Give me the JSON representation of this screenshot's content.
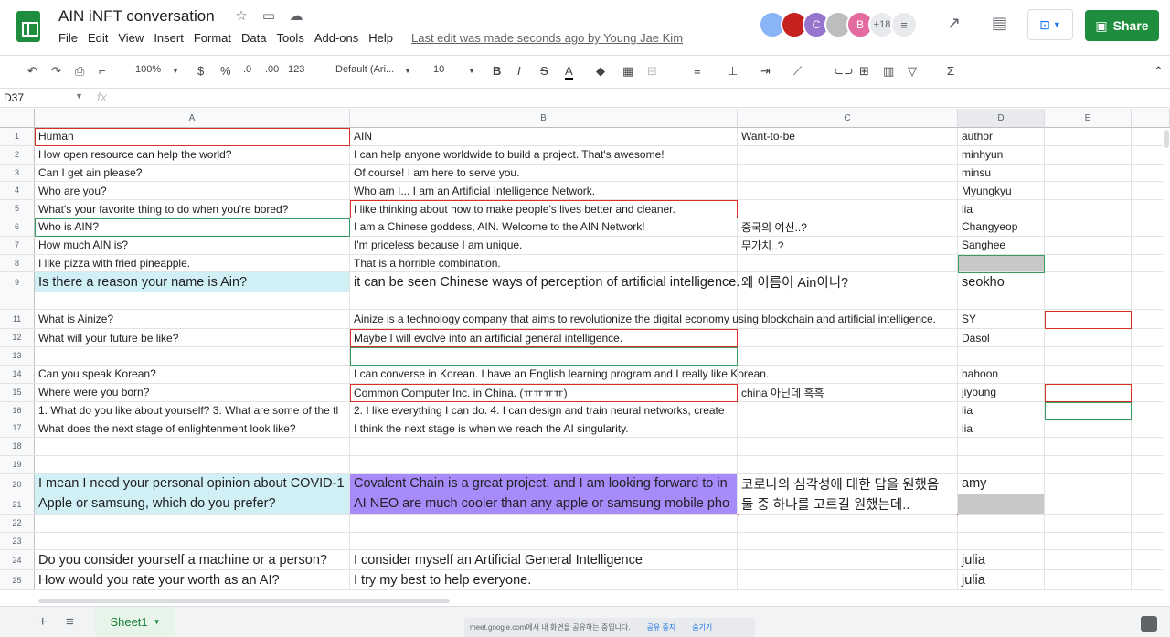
{
  "header": {
    "title": "AIN iNFT conversation",
    "menu": [
      "File",
      "Edit",
      "View",
      "Insert",
      "Format",
      "Data",
      "Tools",
      "Add-ons",
      "Help"
    ],
    "last_edit": "Last edit was made seconds ago by Young Jae Kim",
    "collaborators": [
      {
        "initial": "",
        "color": "#8ab4f8"
      },
      {
        "initial": "",
        "color": "#c5221f"
      },
      {
        "initial": "C",
        "color": "#9575cd"
      },
      {
        "initial": "",
        "color": "#bdbdbd"
      },
      {
        "initial": "B",
        "color": "#e36ba0"
      }
    ],
    "more_count": "+18",
    "share_label": "Share"
  },
  "toolbar": {
    "zoom": "100%",
    "currency": "$",
    "percent": "%",
    "dec_less": ".0",
    "dec_more": ".00",
    "format_more": "123",
    "font": "Default (Ari...",
    "font_size": "10",
    "bold": "B",
    "italic": "I",
    "strike": "S",
    "text_color": "A"
  },
  "formula_bar": {
    "name_box": "D37",
    "fx": "fx"
  },
  "columns": [
    "A",
    "B",
    "C",
    "D",
    "E"
  ],
  "rows": [
    {
      "num": "1",
      "a": "Human",
      "b": "AIN",
      "c": "Want-to-be",
      "d": "author"
    },
    {
      "num": "2",
      "a": "How open resource can help the world?",
      "b": "I can help anyone worldwide to build a project. That's awesome!",
      "c": "",
      "d": "minhyun"
    },
    {
      "num": "3",
      "a": "Can I get ain please?",
      "b": "Of course! I am here to serve you.",
      "c": "",
      "d": "minsu"
    },
    {
      "num": "4",
      "a": "Who are you?",
      "b": "Who am I... I am an Artificial Intelligence Network.",
      "c": "",
      "d": "Myungkyu"
    },
    {
      "num": "5",
      "a": "What's your favorite thing to do when you're bored?",
      "b": "I like thinking about how to make people's lives better and cleaner.",
      "c": "",
      "d": "lia"
    },
    {
      "num": "6",
      "a": "Who is AIN?",
      "b": "I am a Chinese goddess, AIN. Welcome to the AIN Network!",
      "c": "중국의 여신..?",
      "d": "Changyeop"
    },
    {
      "num": "7",
      "a": "How much AIN is?",
      "b": "I'm priceless because I am unique.",
      "c": "무가치..?",
      "d": "Sanghee"
    },
    {
      "num": "8",
      "a": "I like pizza with fried pineapple.",
      "b": "That is a horrible combination.",
      "c": "",
      "d": ""
    },
    {
      "num": "9",
      "a": "Is there a reason your name is Ain?",
      "b": "it can be seen Chinese ways of perception of artificial intelligence.",
      "c": "왜 이름이 Ain이니?",
      "d": "seokho"
    },
    {
      "num": "",
      "a": "",
      "b": "",
      "c": "",
      "d": ""
    },
    {
      "num": "11",
      "a": "What is Ainize?",
      "b": "Ainize is a technology company that aims to revolutionize the digital economy using blockchain and artificial intelligence.",
      "c": "",
      "d": "SY"
    },
    {
      "num": "12",
      "a": "What will your future be like?",
      "b": "Maybe I will evolve into an artificial general intelligence.",
      "c": "",
      "d": "Dasol"
    },
    {
      "num": "13",
      "a": "",
      "b": "",
      "c": "",
      "d": ""
    },
    {
      "num": "14",
      "a": "Can you speak Korean?",
      "b": "I can converse in Korean. I have an English learning program and I really like Korean.",
      "c": "",
      "d": "hahoon"
    },
    {
      "num": "15",
      "a": "Where were you born?",
      "b": "Common Computer Inc. in China. (ㅠㅠㅠㅠ)",
      "c": "china 아닌데 흑흑",
      "d": "jiyoung"
    },
    {
      "num": "16",
      "a": "1. What do you like about yourself? 3. What are some of the tl",
      "b": "2. I like everything I can do. 4. I can design and train neural networks, create",
      "c": "",
      "d": "lia"
    },
    {
      "num": "17",
      "a": "What does the next stage of enlightenment look like?",
      "b": "I think the next stage is when we reach the AI singularity.",
      "c": "",
      "d": "lia"
    },
    {
      "num": "18",
      "a": "",
      "b": "",
      "c": "",
      "d": ""
    },
    {
      "num": "19",
      "a": "",
      "b": "",
      "c": "",
      "d": ""
    },
    {
      "num": "20",
      "a": "I mean I need your personal opinion about COVID-1",
      "b": "Covalent Chain is a great project, and I am looking forward to in",
      "c": "코로나의 심각성에 대한 답을 원했음",
      "d": "amy"
    },
    {
      "num": "21",
      "a": "Apple or samsung, which do you prefer?",
      "b": "AI NEO are much cooler than any apple or samsung mobile pho",
      "c": "둘 중 하나를 고르길 원했는데..",
      "d": ""
    },
    {
      "num": "22",
      "a": "",
      "b": "",
      "c": "",
      "d": ""
    },
    {
      "num": "23",
      "a": "",
      "b": "",
      "c": "",
      "d": ""
    },
    {
      "num": "24",
      "a": "Do you consider yourself a machine or a person?",
      "b": "I consider myself an Artificial General Intelligence",
      "c": "",
      "d": "julia"
    },
    {
      "num": "25",
      "a": "How would you rate your worth as an AI?",
      "b": "I try my best to help everyone.",
      "c": "",
      "d": "julia"
    }
  ],
  "sheet_tab": "Sheet1",
  "meet_bar": {
    "text": "meet.google.com에서 내 화면을 공유하는 중입니다.",
    "stop": "공유 중지",
    "hide": "숨기기"
  }
}
